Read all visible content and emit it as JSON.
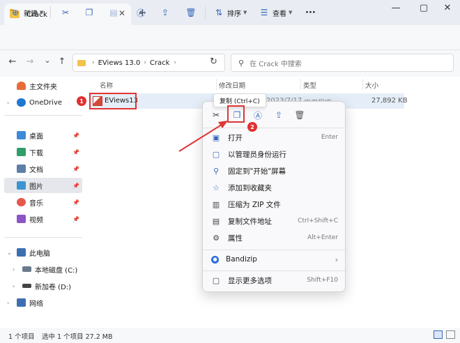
{
  "tab": {
    "title": "Crack",
    "close": "✕",
    "new": "+"
  },
  "window_controls": {
    "minimize": "—",
    "maximize": "▢",
    "close": "✕"
  },
  "toolbar": {
    "new_label": "新建",
    "sort_label": "排序",
    "view_label": "查看",
    "more_label": "···"
  },
  "nav": {
    "back": "←",
    "forward": "→",
    "history": "⌄",
    "up": "↑",
    "breadcrumbs": [
      "EViews 13.0",
      "Crack"
    ],
    "refresh": "↻",
    "search_placeholder": "在 Crack 中搜索"
  },
  "sidebar": {
    "items": [
      {
        "label": "主文件夹",
        "color": "#e86b3a"
      },
      {
        "label": "OneDrive",
        "color": "#1f78d1"
      },
      {
        "label": "桌面",
        "color": "#3c8ad8"
      },
      {
        "label": "下载",
        "color": "#2f9e6a"
      },
      {
        "label": "文档",
        "color": "#5c7fa8"
      },
      {
        "label": "图片",
        "color": "#3c94cf"
      },
      {
        "label": "音乐",
        "color": "#e4574b"
      },
      {
        "label": "视频",
        "color": "#8b55c8"
      },
      {
        "label": "此电脑",
        "color": "#3d6eb0"
      },
      {
        "label": "本地磁盘 (C:)",
        "color": "#6b7a8c"
      },
      {
        "label": "新加卷 (D:)",
        "color": "#444"
      },
      {
        "label": "网络",
        "color": "#3d6eb0"
      }
    ]
  },
  "columns": {
    "name": "名称",
    "date": "修改日期",
    "type": "类型",
    "size": "大小"
  },
  "file": {
    "name": "EViews13",
    "date": "2023/7/17",
    "type": "应用程序",
    "size": "27,892 KB"
  },
  "markers": {
    "one": "1",
    "two": "2"
  },
  "tooltip": "复制 (Ctrl+C)",
  "context_menu": {
    "items": [
      {
        "label": "打开",
        "shortcut": "Enter",
        "icon": "open-icon"
      },
      {
        "label": "以管理员身份运行",
        "shortcut": "",
        "icon": "shield-icon"
      },
      {
        "label": "固定到\"开始\"屏幕",
        "shortcut": "",
        "icon": "pin-icon"
      },
      {
        "label": "添加到收藏夹",
        "shortcut": "",
        "icon": "star-icon"
      },
      {
        "label": "压缩为 ZIP 文件",
        "shortcut": "",
        "icon": "zip-icon"
      },
      {
        "label": "复制文件地址",
        "shortcut": "Ctrl+Shift+C",
        "icon": "copy-path-icon"
      },
      {
        "label": "属性",
        "shortcut": "Alt+Enter",
        "icon": "wrench-icon"
      },
      {
        "label": "Bandizip",
        "shortcut": "›",
        "icon": "bandizip-icon"
      },
      {
        "label": "显示更多选项",
        "shortcut": "Shift+F10",
        "icon": "more-options-icon"
      }
    ]
  },
  "status": {
    "count": "1 个项目",
    "selected": "选中 1 个项目 27.2 MB"
  },
  "colors": {
    "accent": "#3567b8",
    "highlight": "#e03535"
  }
}
